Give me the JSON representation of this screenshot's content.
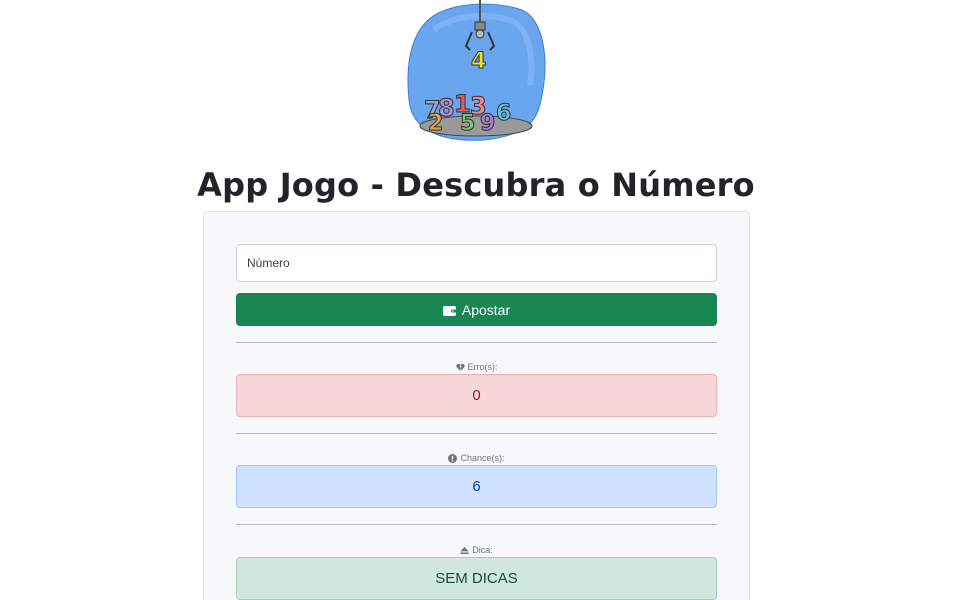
{
  "app": {
    "title": "App Jogo - Descubra o Número"
  },
  "form": {
    "number_placeholder": "Número",
    "number_value": "",
    "bet_label": "Apostar",
    "bet_icon": "wallet-icon"
  },
  "stats": {
    "errors": {
      "label": "Erro(s):",
      "icon": "heart-broken-icon",
      "value": "0"
    },
    "chances": {
      "label": "Chance(s):",
      "icon": "exclamation-circle-icon",
      "value": "6"
    },
    "hint": {
      "label": "Dica:",
      "icon": "eject-icon",
      "value": "SEM DICAS"
    }
  },
  "colors": {
    "primary_button": "#198754",
    "danger_bg": "#f8d7da",
    "primary_bg": "#cfe2ff",
    "success_bg": "#d1e7dd"
  }
}
